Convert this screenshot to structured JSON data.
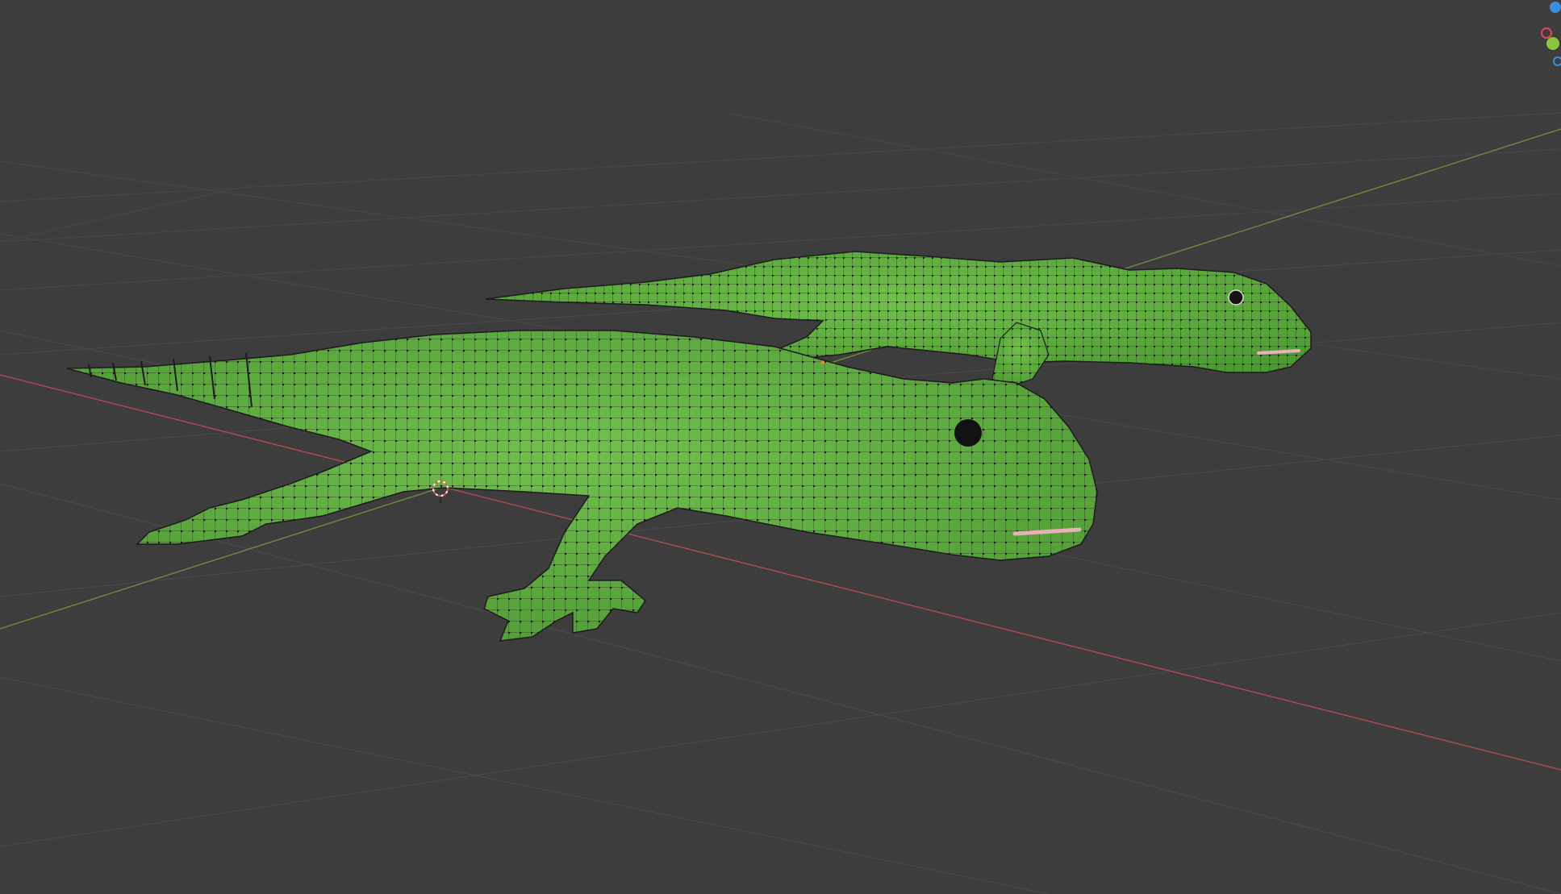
{
  "app": {
    "name": ""
  },
  "viewport": {
    "mode": "edit",
    "shading": "material-preview",
    "background_color": "#3d3d3d",
    "grid_color": "#4c4c4c",
    "x_axis_color": "#b04a52",
    "y_axis_color": "#6f8a3c"
  },
  "scene": {
    "objects": [
      {
        "name": "",
        "kind": "gecko-mesh",
        "color": "#5fae3f",
        "state": "edit-mode-wireframe"
      },
      {
        "name": "",
        "kind": "gecko-mesh",
        "color": "#5fae3f",
        "state": "edit-mode-wireframe"
      }
    ],
    "cursor": {
      "icon": "3d-cursor-icon"
    }
  },
  "gizmo": {
    "icons": [
      "gizmo-x-axis-icon",
      "gizmo-y-axis-icon",
      "gizmo-z-axis-icon"
    ],
    "colors": {
      "x": "#e0475a",
      "y": "#8cc63f",
      "z": "#3a8fe0"
    }
  }
}
